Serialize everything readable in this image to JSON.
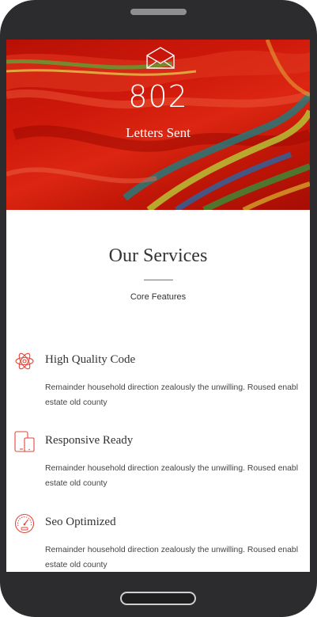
{
  "hero": {
    "icon": "envelope-icon",
    "count": "802",
    "label": "Letters Sent"
  },
  "services": {
    "title": "Our Services",
    "subtitle": "Core Features",
    "accent_color": "#e3463a",
    "items": [
      {
        "icon": "atom-icon",
        "title": "High Quality Code",
        "desc_line1": "Remainder household direction zealously the unwilling. Roused enabl",
        "desc_line2": "estate old county"
      },
      {
        "icon": "devices-icon",
        "title": "Responsive Ready",
        "desc_line1": "Remainder household direction zealously the unwilling. Roused enabl",
        "desc_line2": "estate old county"
      },
      {
        "icon": "speedometer-icon",
        "title": "Seo Optimized",
        "desc_line1": "Remainder household direction zealously the unwilling. Roused enabl",
        "desc_line2": "estate old county"
      }
    ]
  }
}
